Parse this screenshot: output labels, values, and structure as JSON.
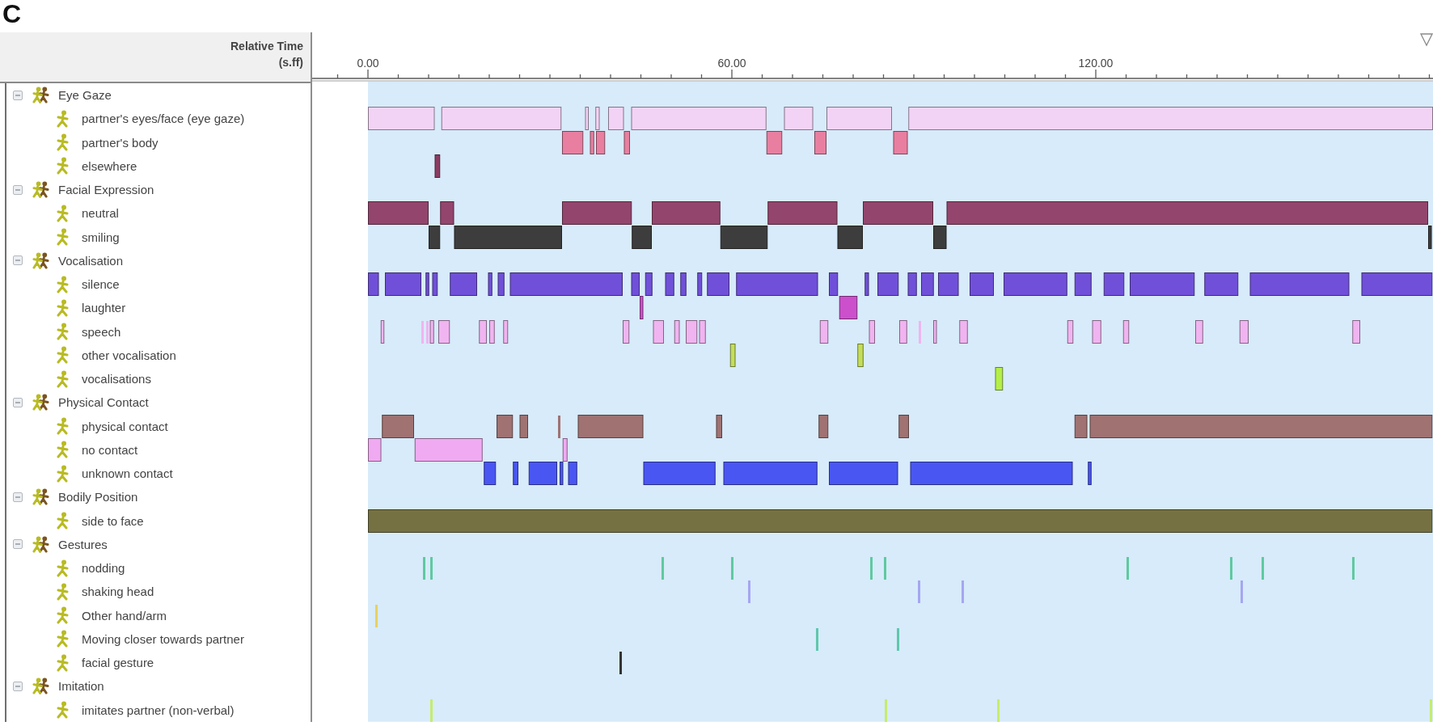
{
  "figure_label": "C",
  "header": {
    "time_label": "Relative Time",
    "time_unit": "(s.ff)"
  },
  "ruler": {
    "ticks": [
      "0.00",
      "60.00",
      "120.00"
    ]
  },
  "tiers": [
    {
      "label": "Eye Gaze",
      "expanded": true,
      "children": [
        {
          "label": "partner's eyes/face (eye gaze)",
          "color": "#f3d3f5"
        },
        {
          "label": "partner's body",
          "color": "#e87fa0"
        },
        {
          "label": "elsewhere",
          "color": "#8c3c62"
        }
      ]
    },
    {
      "label": "Facial Expression",
      "expanded": true,
      "children": [
        {
          "label": "neutral",
          "color": "#93456d"
        },
        {
          "label": "smiling",
          "color": "#3d3d3d"
        }
      ]
    },
    {
      "label": "Vocalisation",
      "expanded": true,
      "children": [
        {
          "label": "silence",
          "color": "#7050d8"
        },
        {
          "label": "laughter",
          "color": "#cc4fcc"
        },
        {
          "label": "speech",
          "color": "#f0b4f0"
        },
        {
          "label": "other vocalisation",
          "color": "#c4de5a"
        },
        {
          "label": "vocalisations",
          "color": "#b6ee48"
        }
      ]
    },
    {
      "label": "Physical Contact",
      "expanded": true,
      "children": [
        {
          "label": "physical contact",
          "color": "#a07272"
        },
        {
          "label": "no contact",
          "color": "#f0aaf2"
        },
        {
          "label": "unknown contact",
          "color": "#4a56f2"
        }
      ]
    },
    {
      "label": "Bodily Position",
      "expanded": true,
      "children": [
        {
          "label": "side to face",
          "color": "#767143"
        }
      ]
    },
    {
      "label": "Gestures",
      "expanded": true,
      "children": [
        {
          "label": "nodding",
          "color": "#5fc9a0"
        },
        {
          "label": "shaking head",
          "color": "#a6a6f2"
        },
        {
          "label": "Other hand/arm",
          "color": "#e8d064"
        },
        {
          "label": "Moving closer towards partner",
          "color": "#5ec8ac"
        },
        {
          "label": "facial gesture",
          "color": "#333333"
        }
      ]
    },
    {
      "label": "Imitation",
      "expanded": true,
      "children": [
        {
          "label": "imitates partner (non-verbal)",
          "color": "#c6ec6c"
        }
      ]
    }
  ]
}
